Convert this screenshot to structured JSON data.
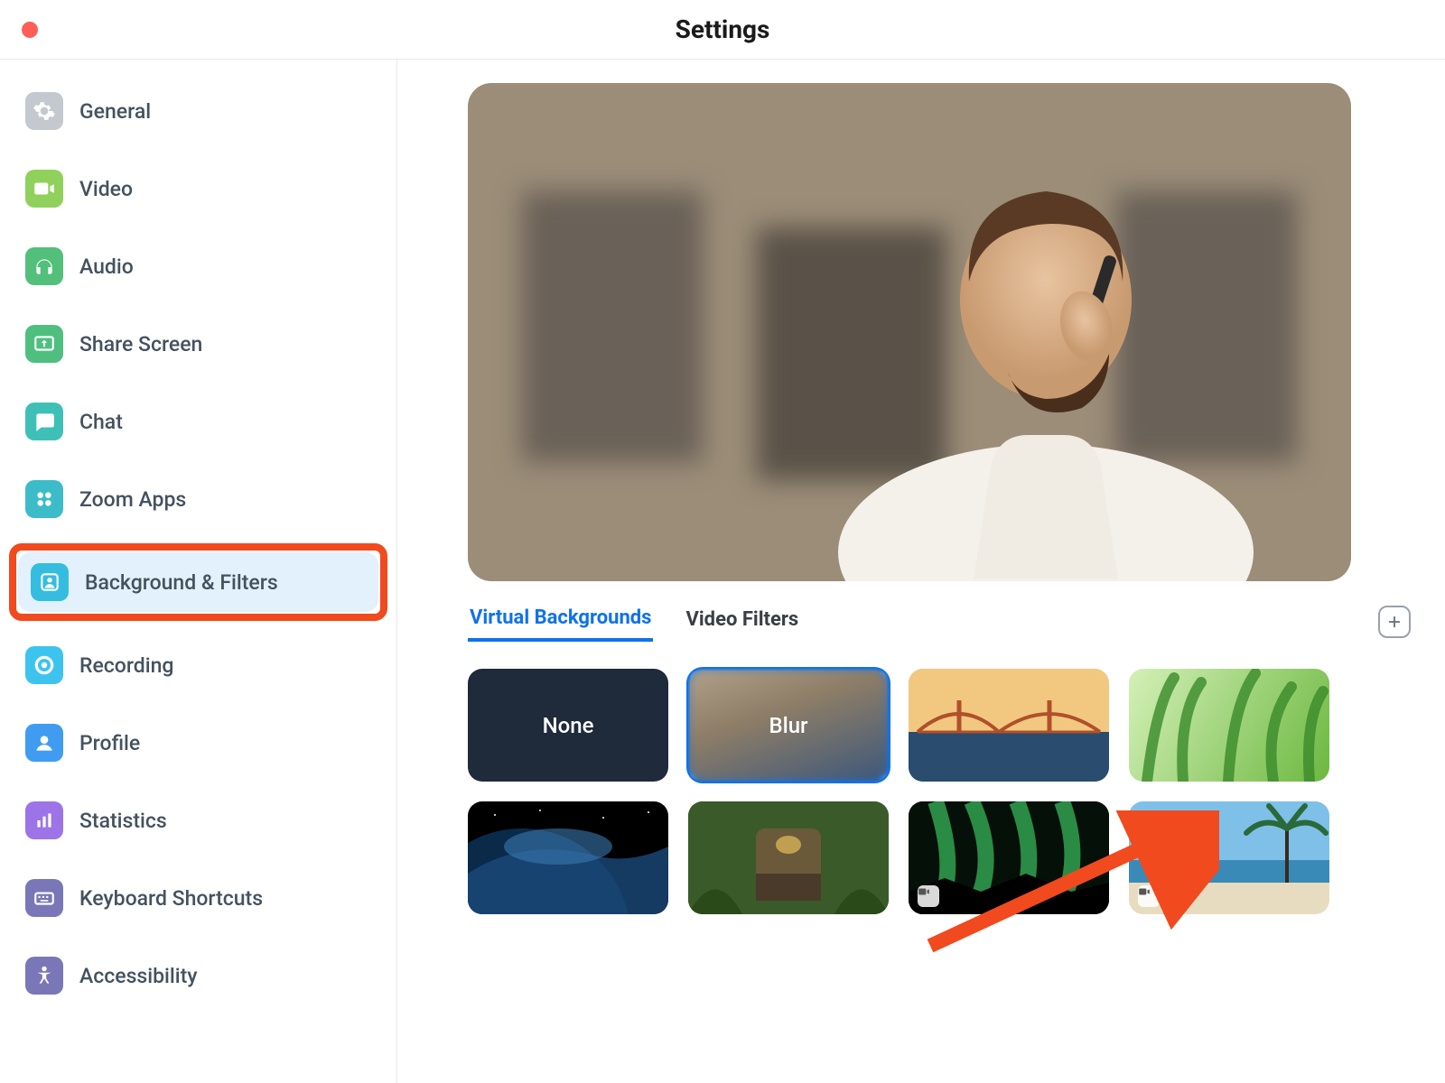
{
  "window": {
    "title": "Settings"
  },
  "sidebar": {
    "items": [
      {
        "label": "General",
        "icon": "gear-icon",
        "color": "#c4c9cf"
      },
      {
        "label": "Video",
        "icon": "video-icon",
        "color": "#8fd15a"
      },
      {
        "label": "Audio",
        "icon": "headphones-icon",
        "color": "#52c07a"
      },
      {
        "label": "Share Screen",
        "icon": "share-screen-icon",
        "color": "#4fbf7f"
      },
      {
        "label": "Chat",
        "icon": "chat-icon",
        "color": "#3fc0b7"
      },
      {
        "label": "Zoom Apps",
        "icon": "apps-icon",
        "color": "#3cbcc9"
      },
      {
        "label": "Background & Filters",
        "icon": "background-icon",
        "color": "#35bde0",
        "selected": true,
        "highlighted": true
      },
      {
        "label": "Recording",
        "icon": "record-icon",
        "color": "#3cc4ef"
      },
      {
        "label": "Profile",
        "icon": "profile-icon",
        "color": "#3f9cf0"
      },
      {
        "label": "Statistics",
        "icon": "statistics-icon",
        "color": "#9d74e8"
      },
      {
        "label": "Keyboard Shortcuts",
        "icon": "keyboard-icon",
        "color": "#7a77b8"
      },
      {
        "label": "Accessibility",
        "icon": "accessibility-icon",
        "color": "#7a77b8"
      }
    ]
  },
  "main": {
    "tabs": [
      {
        "label": "Virtual Backgrounds",
        "active": true
      },
      {
        "label": "Video Filters",
        "active": false
      }
    ],
    "backgrounds": [
      {
        "label": "None",
        "kind": "none"
      },
      {
        "label": "Blur",
        "kind": "blur",
        "selected": true
      },
      {
        "label": "",
        "kind": "bridge"
      },
      {
        "label": "",
        "kind": "grass"
      },
      {
        "label": "",
        "kind": "earth"
      },
      {
        "label": "",
        "kind": "jungle"
      },
      {
        "label": "",
        "kind": "aurora",
        "video": true
      },
      {
        "label": "",
        "kind": "beach",
        "video": true
      }
    ]
  },
  "annotations": {
    "highlight_box_color": "#f04a1e",
    "arrow_color": "#f04a1e"
  }
}
